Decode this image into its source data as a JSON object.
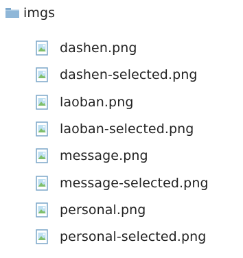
{
  "folder": {
    "icon": "folder-icon",
    "label": "imgs"
  },
  "files": [
    {
      "icon": "image-file-icon",
      "label": "dashen.png"
    },
    {
      "icon": "image-file-icon",
      "label": "dashen-selected.png"
    },
    {
      "icon": "image-file-icon",
      "label": "laoban.png"
    },
    {
      "icon": "image-file-icon",
      "label": "laoban-selected.png"
    },
    {
      "icon": "image-file-icon",
      "label": "message.png"
    },
    {
      "icon": "image-file-icon",
      "label": "message-selected.png"
    },
    {
      "icon": "image-file-icon",
      "label": "personal.png"
    },
    {
      "icon": "image-file-icon",
      "label": "personal-selected.png"
    }
  ],
  "colors": {
    "folder_body": "#8fb7d8",
    "folder_tab": "#6d9cc4",
    "file_frame": "#7aa6c8",
    "file_green": "#7fbf6a",
    "file_sky": "#bfe0f2"
  }
}
